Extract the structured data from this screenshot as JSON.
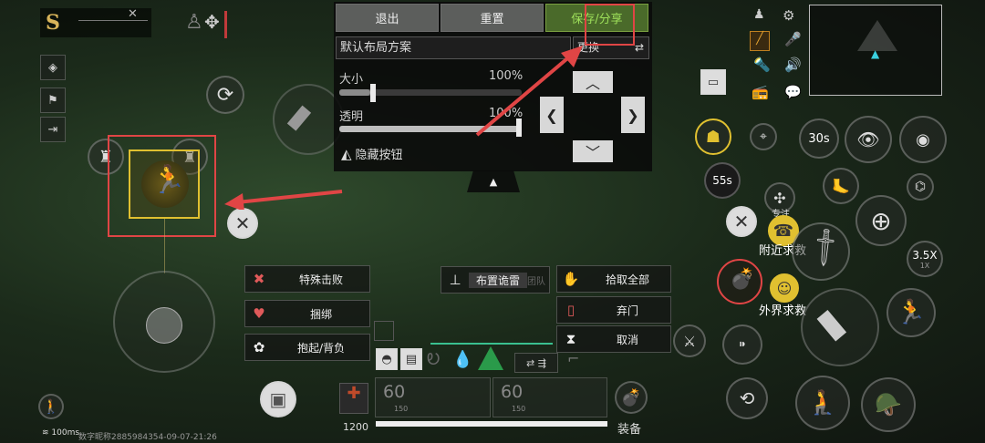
{
  "panel": {
    "tabs": [
      "退出",
      "重置",
      "保存/分享"
    ],
    "layout_label": "默认布局方案",
    "change_label": "更换",
    "size_label": "大小",
    "size_value": "100%",
    "size_fill": 0.17,
    "opacity_label": "透明",
    "opacity_value": "100%",
    "opacity_fill": 1.0,
    "hide_label": "隐藏按钮"
  },
  "actions_left": [
    "特殊击败",
    "捆绑",
    "抱起/背负"
  ],
  "actions_mid": {
    "trap": "布置诡雷",
    "team": "团队"
  },
  "actions_right": [
    "拾取全部",
    "弃门",
    "取消"
  ],
  "right_hud": {
    "focus": "专注",
    "nearby_help": "附近求救",
    "outside_help": "外界求救",
    "timer_30": "30s",
    "timer_55": "55s",
    "scope_zoom": "3.5X",
    "scope_sub": "1X"
  },
  "bottom": {
    "ammo_left": "60",
    "ammo_left_reserve": "150",
    "ammo_right": "60",
    "ammo_right_reserve": "150",
    "backpack_count": "1200",
    "equip_label": "装备"
  },
  "status": {
    "ping": "100ms",
    "id_line": "数字昵称2885984354-09-07-21:26"
  },
  "colors": {
    "highlight_red": "#e04545",
    "yellow_frame": "#e0c030",
    "active_tab_green": "#9ee05a"
  }
}
